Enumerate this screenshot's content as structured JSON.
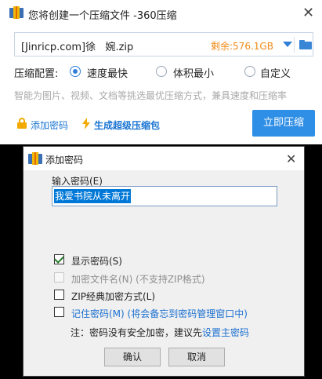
{
  "main_window": {
    "title": "您将创建一个压缩文件 -360压缩",
    "close_glyph": "✕",
    "path_value": "[Jinricp.com]徐   婉.zip",
    "free_space": "剩余:576.1GB",
    "config_label": "压缩配置:",
    "options": [
      {
        "label": "速度最快",
        "selected": true
      },
      {
        "label": "体积最小",
        "selected": false
      },
      {
        "label": "自定义",
        "selected": false
      }
    ],
    "hint": "智能为图片、视频、文档等挑选最优压缩方式，兼具速度和压缩率",
    "add_password_link": "添加密码",
    "super_compress_link": "生成超级压缩包",
    "compress_button": "立即压缩"
  },
  "password_dialog": {
    "title": "添加密码",
    "close_glyph": "✕",
    "input_label": "输入密码(E)",
    "password_value": "我爱书院从未离开",
    "checkboxes": [
      {
        "label": "显示密码(S)",
        "checked": true,
        "disabled": false
      },
      {
        "label": "加密文件名(N) (不支持ZIP格式)",
        "checked": false,
        "disabled": true
      },
      {
        "label": "ZIP经典加密方式(L)",
        "checked": false,
        "disabled": false
      },
      {
        "label": "记住密码(M) (将会备忘到密码管理窗口中)",
        "checked": false,
        "disabled": false
      }
    ],
    "note_prefix": "注：密码没有安全加密，建议先",
    "note_link": "设置主密码",
    "ok_button": "确认",
    "cancel_button": "取消"
  },
  "colors": {
    "accent": "#2f8ee5",
    "link": "#1a75d2",
    "free_space": "#f08a16",
    "selection": "#0078d7"
  },
  "icons": [
    "app-icon",
    "dropdown-arrow-icon",
    "folder-icon",
    "lock-icon",
    "lightning-icon",
    "check-icon"
  ]
}
